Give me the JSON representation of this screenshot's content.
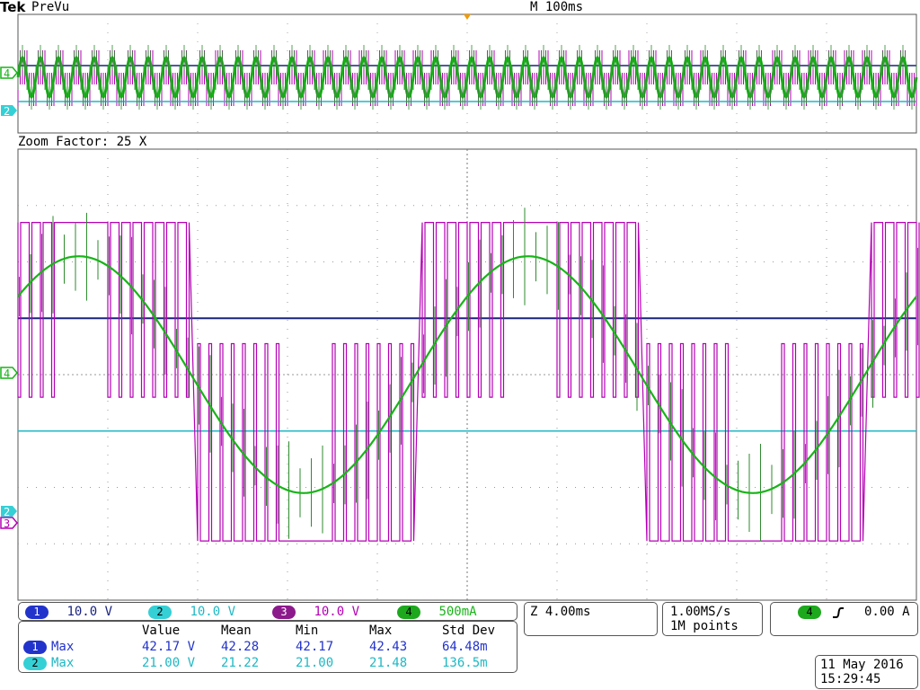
{
  "header": {
    "brand": "Tek",
    "mode": "PreVu",
    "timebase": "M 100ms",
    "zoom_factor": "Zoom Factor: 25 X"
  },
  "colors": {
    "ch1": "#1a237e",
    "ch2": "#1fb8c4",
    "ch3": "#b400b4",
    "ch4": "#18b418",
    "ch1_pill": "#2233cc",
    "ch2_pill": "#35d0d6",
    "ch3_pill": "#8c1a8c",
    "ch4_pill": "#1ea81e"
  },
  "markers": {
    "ch4": "4",
    "ch2": "2",
    "ch3": "3"
  },
  "channels": [
    {
      "num": "1",
      "scale": "10.0 V"
    },
    {
      "num": "2",
      "scale": "10.0 V"
    },
    {
      "num": "3",
      "scale": "10.0 V"
    },
    {
      "num": "4",
      "scale": "500mA"
    }
  ],
  "zoom_timebase": "Z 4.00ms",
  "acquisition": {
    "rate": "1.00MS/s",
    "points": "1M points"
  },
  "trigger": {
    "channel": "4",
    "slope_icon": "rising-edge-icon",
    "level": "0.00 A"
  },
  "measurements": {
    "headers": [
      "Value",
      "Mean",
      "Min",
      "Max",
      "Std Dev"
    ],
    "rows": [
      {
        "channel": "1",
        "type": "Max",
        "value": "42.17 V",
        "mean": "42.28",
        "min": "42.17",
        "max": "42.43",
        "std": "64.48m"
      },
      {
        "channel": "2",
        "type": "Max",
        "value": "21.00 V",
        "mean": "21.22",
        "min": "21.00",
        "max": "21.48",
        "std": "136.5m"
      }
    ]
  },
  "datetime": {
    "date": "11 May 2016",
    "time": "15:29:45"
  },
  "chart_data": {
    "type": "line",
    "xlabel": "",
    "ylabel": "",
    "x_range_ms": [
      0,
      40
    ],
    "grid": true,
    "series": [
      {
        "name": "",
        "channel": "1",
        "shape": "dc",
        "level_div": 1.0
      },
      {
        "name": "",
        "channel": "2",
        "shape": "dc",
        "level_div": -1.0
      },
      {
        "name": "",
        "channel": "3",
        "shape": "pwm",
        "high_div": 2.7,
        "low_div": -2.95,
        "period_ms": 20
      },
      {
        "name": "",
        "channel": "4",
        "shape": "sine",
        "amplitude_div": 2.1,
        "period_ms": 20
      }
    ]
  }
}
